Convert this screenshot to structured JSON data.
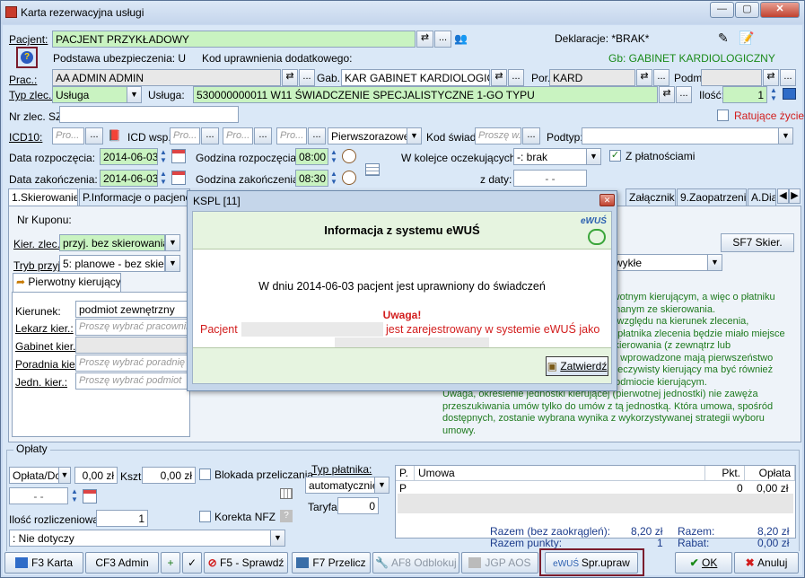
{
  "window": {
    "title": "Karta rezerwacyjna usługi",
    "controls": [
      "—",
      "▢",
      "✕"
    ]
  },
  "patient": {
    "label": "Pacjent:",
    "name": "PACJENT PRZYKŁADOWY",
    "declaration": "Deklaracje: *BRAK*",
    "insurance": "Podstawa ubezpieczenia: U",
    "extra_code": "Kod uprawnienia dodatkowego:",
    "gb": "Gb: GABINET KARDIOLOGICZNY"
  },
  "prac": {
    "label": "Prac.:",
    "value": "AA ADMIN ADMIN",
    "gab_label": "Gab.:",
    "gab_value": "KAR GABINET KARDIOLOGICZN",
    "por_label": "Por.",
    "por_value": "KARD",
    "podm_label": "Podm"
  },
  "service": {
    "type_label": "Typ zlec.:",
    "type_value": "Usługa",
    "label": "Usługa:",
    "value": "530000000011 W11 ŚWIADCZENIE SPECJALISTYCZNE 1-GO TYPU",
    "qty_label": "Ilość:",
    "qty_value": "1"
  },
  "order": {
    "nr_label": "Nr zlec. SZ:",
    "rescue_label": "Ratujące życie"
  },
  "icd": {
    "label": "ICD10:",
    "ph": "Pro...",
    "wsp_label": "ICD wsp.:",
    "priority": "Pierwszorazowe",
    "kod_label": "Kod świad.",
    "kod_ph": "Proszę w...",
    "podtyp_label": "Podtyp:"
  },
  "dates": {
    "start_label": "Data rozpoczęcia:",
    "start": "2014-06-03",
    "end_label": "Data zakończenia:",
    "end": "2014-06-03",
    "time_start_label": "Godzina rozpoczęcia:",
    "time_start": "08:00",
    "time_end_label": "Godzina zakończenia:",
    "time_end": "08:30",
    "queue_label": "W kolejce oczekujących:",
    "queue_value": "-: brak",
    "paid_label": "Z płatnościami",
    "zdaty_label": "z daty:",
    "zdaty_value": "-  -"
  },
  "tabs": [
    "1.Skierowanie",
    "P.Informacje o pacjencie",
    "Załączniki",
    "9.Zaopatrzenie",
    "A.Dia"
  ],
  "referral": {
    "nr_kuponu": "Nr Kuponu:",
    "kier_label": "Kier. zlec.:",
    "kier_value": "przyj. bez skierowania",
    "tryb_label": "Tryb przyj.:",
    "tryb_value": "5: planowe - bez skier.",
    "sf7": "SF7 Skier.",
    "zwykle": "zwykłe",
    "subtab": "Pierwotny kierujący",
    "kierunek_label": "Kierunek:",
    "kierunek_value": "podmiot zewnętrzny",
    "lekarz_label": "Lekarz kier.:",
    "lekarz_ph": "Proszę wybrać pracownika",
    "gabinet_label": "Gabinet kier.:",
    "poradnia_label": "Poradnia kier.:",
    "poradnia_ph": "Proszę wybrać poradnię",
    "jedn_label": "Jedn. kier.:",
    "jedn_ph": "Proszę wybrać podmiot",
    "info": [
      "rwotnym kierującym, a więc o płatniku",
      "onanym ze skierowania.",
      "z względu na kierunek zlecenia,",
      "o płatnika zlecenia będzie miało miejsce",
      "skierowania (z zewnątrz lub",
      "tu wprowadzone mają pierwszeństwo",
      "rzeczywisty kierujący ma być również",
      "podmiocie kierującym.",
      "Uwaga, określenie jednostki kierującej (pierwotnej jednostki) nie zawęża",
      "przeszukiwania umów tylko do umów z tą jednostką. Która umowa, spośród",
      "dostępnych, zostanie wybrana wynika z wykorzystywanej strategii wyboru umowy."
    ]
  },
  "dialog": {
    "title": "KSPL [11]",
    "heading": "Informacja z systemu eWUŚ",
    "logo": "eWUŚ",
    "line1": "W dniu 2014-06-03 pacjent jest uprawniony do świadczeń",
    "warning": "Uwaga!",
    "line2a": "Pacjent",
    "line2b": "jest zarejestrowany w systemie eWUŚ jako",
    "confirm": "Zatwierdź"
  },
  "fees": {
    "group": "Opłaty",
    "fee_label": "Opłata/Dc",
    "fee_value": "0,00 zł",
    "kszt_label": "Kszt:",
    "kszt_value": "0,00 zł",
    "blokada": "Blokada przeliczania",
    "korekta": "Korekta NFZ",
    "payer_label": "Typ płatnika:",
    "payer_value": "automatycznie",
    "tariff_label": "Taryfa:",
    "tariff_value": "0",
    "date_value": "-  -",
    "count_label": "Ilość rozliczeniowa:",
    "count_value": "1",
    "nd_value": ": Nie dotyczy",
    "table_headers": [
      "P.",
      "Umowa",
      "Pkt.",
      "Opłata"
    ],
    "row": {
      "p": "P",
      "pkt": "0",
      "oplata": "0,00 zł"
    },
    "razem_label": "Razem (bez zaokrągleń):",
    "razem_value": "8,20 zł",
    "punkty_label": "Razem punkty:",
    "punkty_value": "1",
    "razem2_label": "Razem:",
    "razem2_value": "8,20 zł",
    "rabat_label": "Rabat:",
    "rabat_value": "0,00 zł"
  },
  "buttons": {
    "f3": "F3 Karta",
    "cf3": "CF3 Admin",
    "f5": "F5 - Sprawdź",
    "f7": "F7 Przelicz",
    "af8": "AF8 Odblokuj",
    "jgp": "JGP AOS",
    "spr": "Spr.upraw",
    "ok": "OK",
    "cancel": "Anuluj"
  }
}
